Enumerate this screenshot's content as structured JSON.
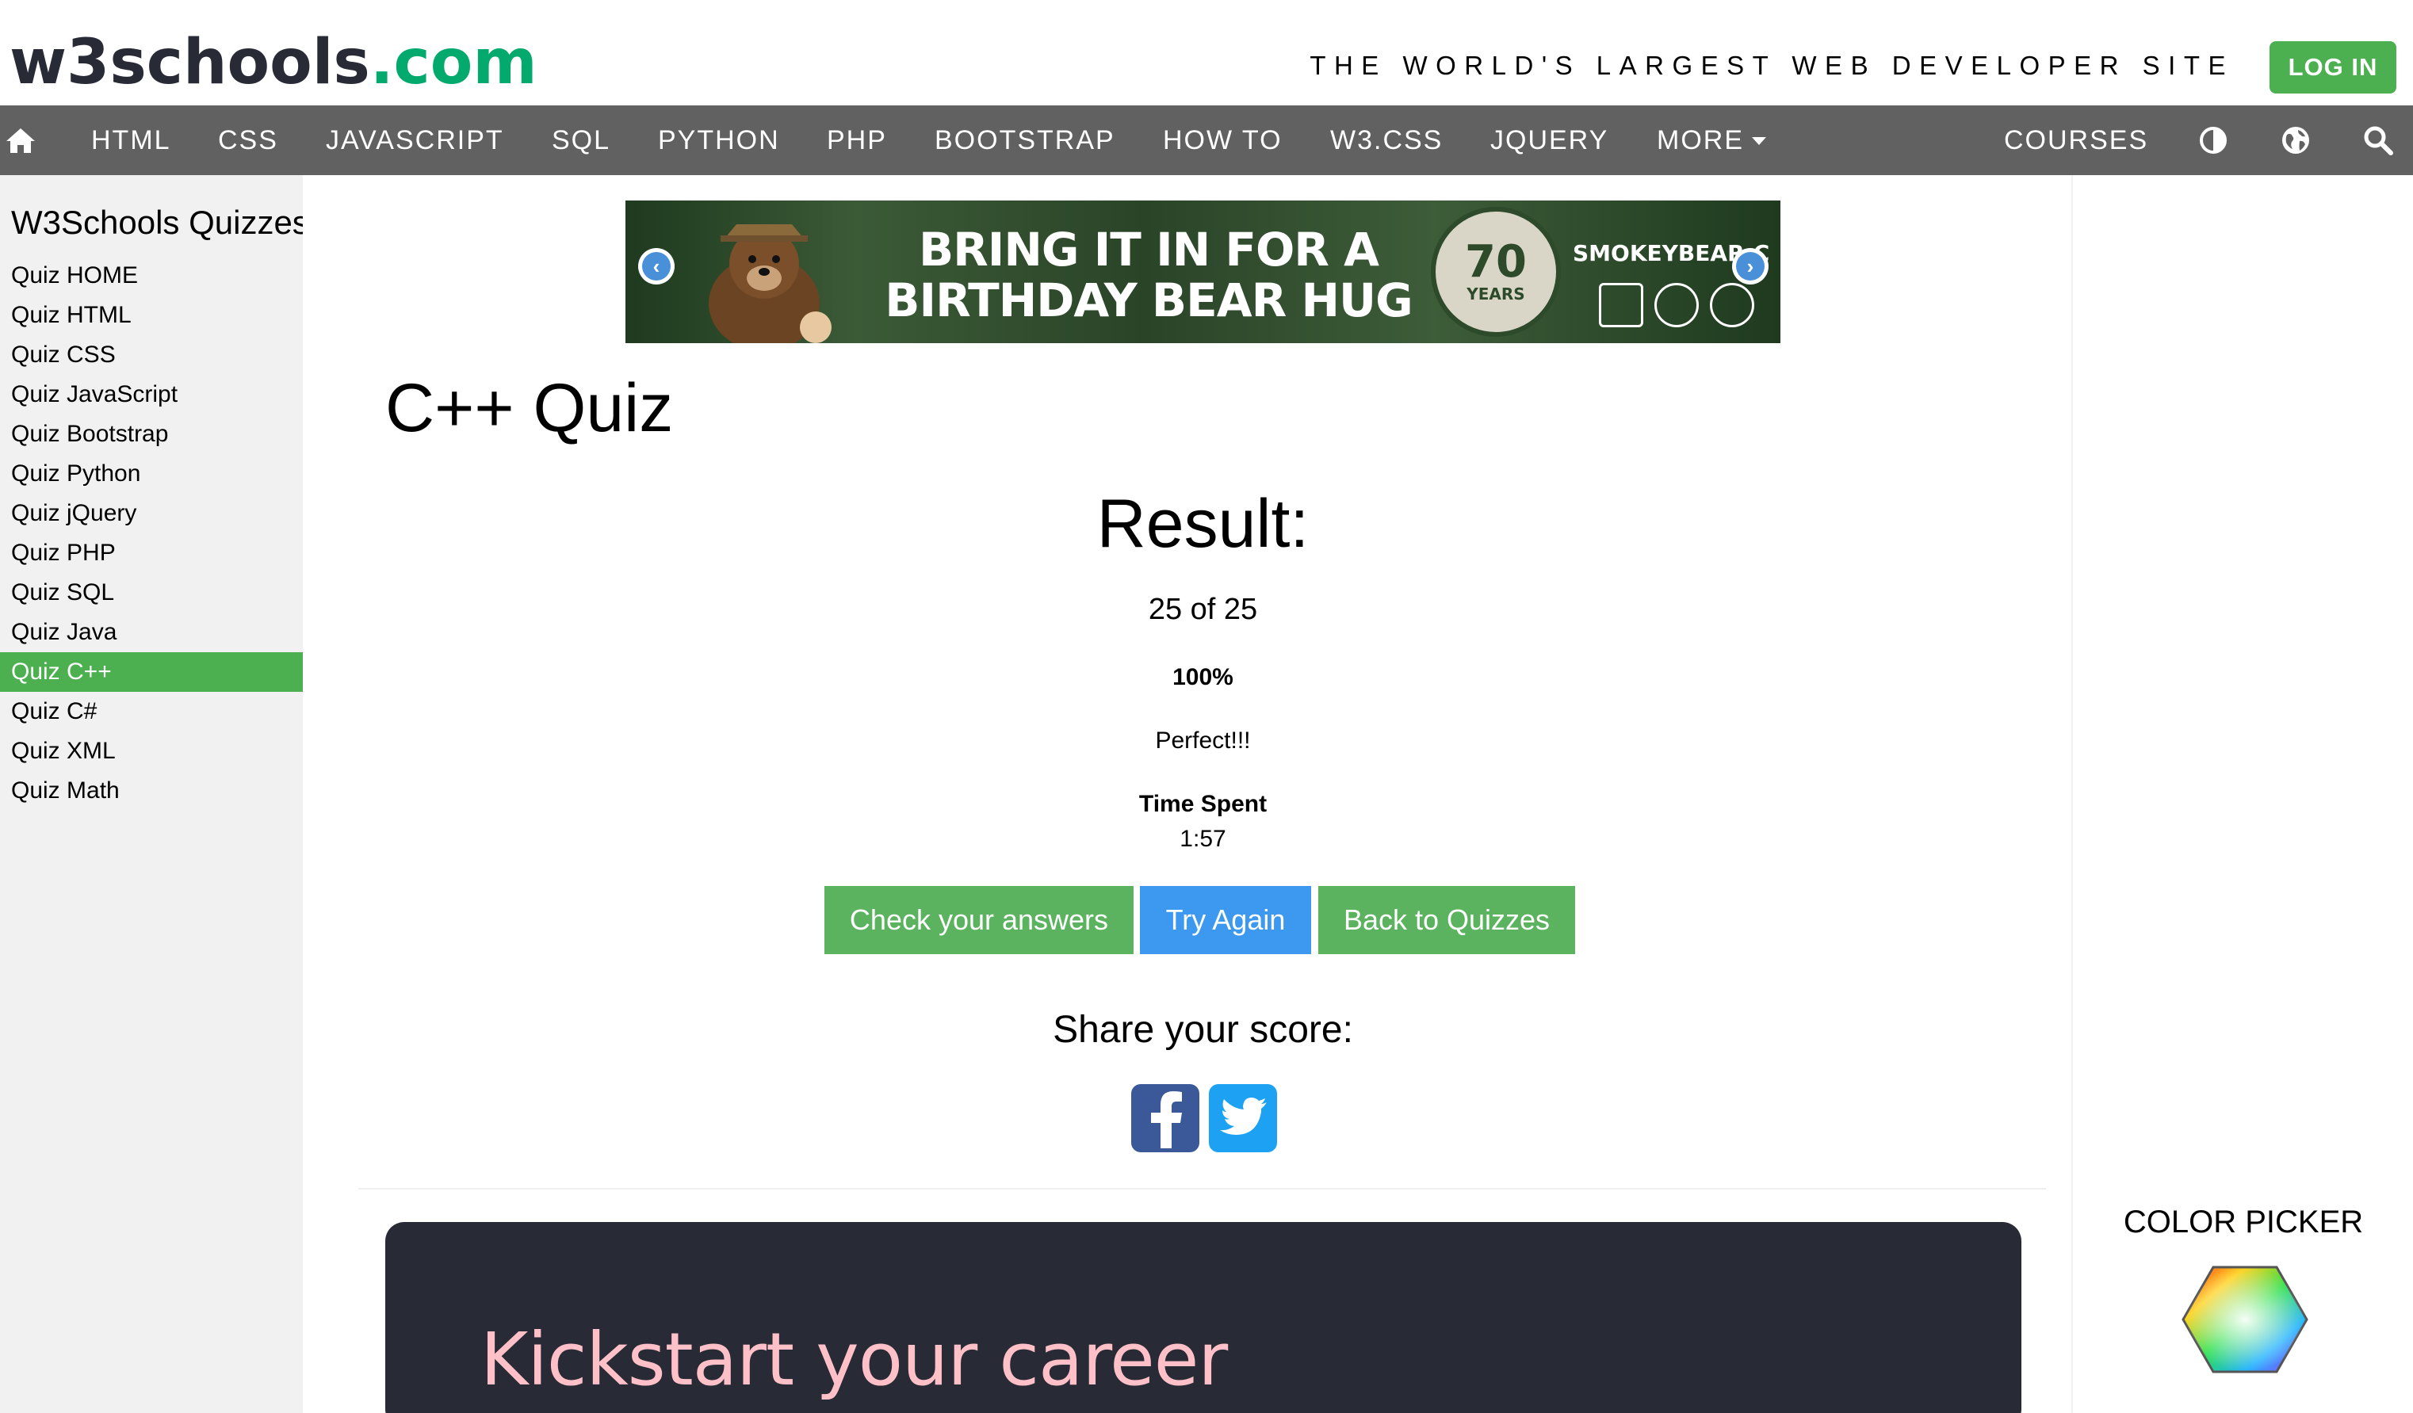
{
  "header": {
    "logo_w3": "w3schools",
    "logo_com": ".com",
    "tagline": "THE WORLD'S LARGEST WEB DEVELOPER SITE",
    "login_label": "LOG IN"
  },
  "nav": {
    "home_icon": "home-icon",
    "items": [
      "HTML",
      "CSS",
      "JAVASCRIPT",
      "SQL",
      "PYTHON",
      "PHP",
      "BOOTSTRAP",
      "HOW TO",
      "W3.CSS",
      "JQUERY"
    ],
    "more_label": "MORE",
    "courses_label": "COURSES",
    "right_icons": [
      "contrast-icon",
      "globe-icon",
      "search-icon"
    ],
    "background": "#616161"
  },
  "sidebar": {
    "title": "W3Schools Quizzes",
    "items": [
      {
        "label": "Quiz HOME",
        "active": false
      },
      {
        "label": "Quiz HTML",
        "active": false
      },
      {
        "label": "Quiz CSS",
        "active": false
      },
      {
        "label": "Quiz JavaScript",
        "active": false
      },
      {
        "label": "Quiz Bootstrap",
        "active": false
      },
      {
        "label": "Quiz Python",
        "active": false
      },
      {
        "label": "Quiz jQuery",
        "active": false
      },
      {
        "label": "Quiz PHP",
        "active": false
      },
      {
        "label": "Quiz SQL",
        "active": false
      },
      {
        "label": "Quiz Java",
        "active": false
      },
      {
        "label": "Quiz C++",
        "active": true
      },
      {
        "label": "Quiz C#",
        "active": false
      },
      {
        "label": "Quiz XML",
        "active": false
      },
      {
        "label": "Quiz Math",
        "active": false
      }
    ],
    "active_color": "#4caf50"
  },
  "ad": {
    "headline_line1": "BRING IT IN FOR A",
    "headline_line2": "BIRTHDAY BEAR HUG",
    "badge_number": "70",
    "badge_text": "YEARS",
    "url": "SMOKEYBEAR.C"
  },
  "main": {
    "page_title": "C++ Quiz",
    "result_heading": "Result:",
    "score": "25 of 25",
    "percent": "100%",
    "verdict": "Perfect!!!",
    "time_label": "Time Spent",
    "time_value": "1:57",
    "buttons": {
      "check": "Check your answers",
      "try_again": "Try Again",
      "back": "Back to Quizzes"
    },
    "share_heading": "Share your score:",
    "share_icons": [
      "facebook-icon",
      "twitter-icon"
    ]
  },
  "right": {
    "color_picker_title": "COLOR PICKER"
  },
  "career": {
    "text": "Kickstart your career"
  },
  "colors": {
    "brand_green": "#04aa6d",
    "button_green": "#5cb35f",
    "button_blue": "#3d99ef",
    "career_bg": "#282a35",
    "career_text": "#ffc0c7"
  }
}
